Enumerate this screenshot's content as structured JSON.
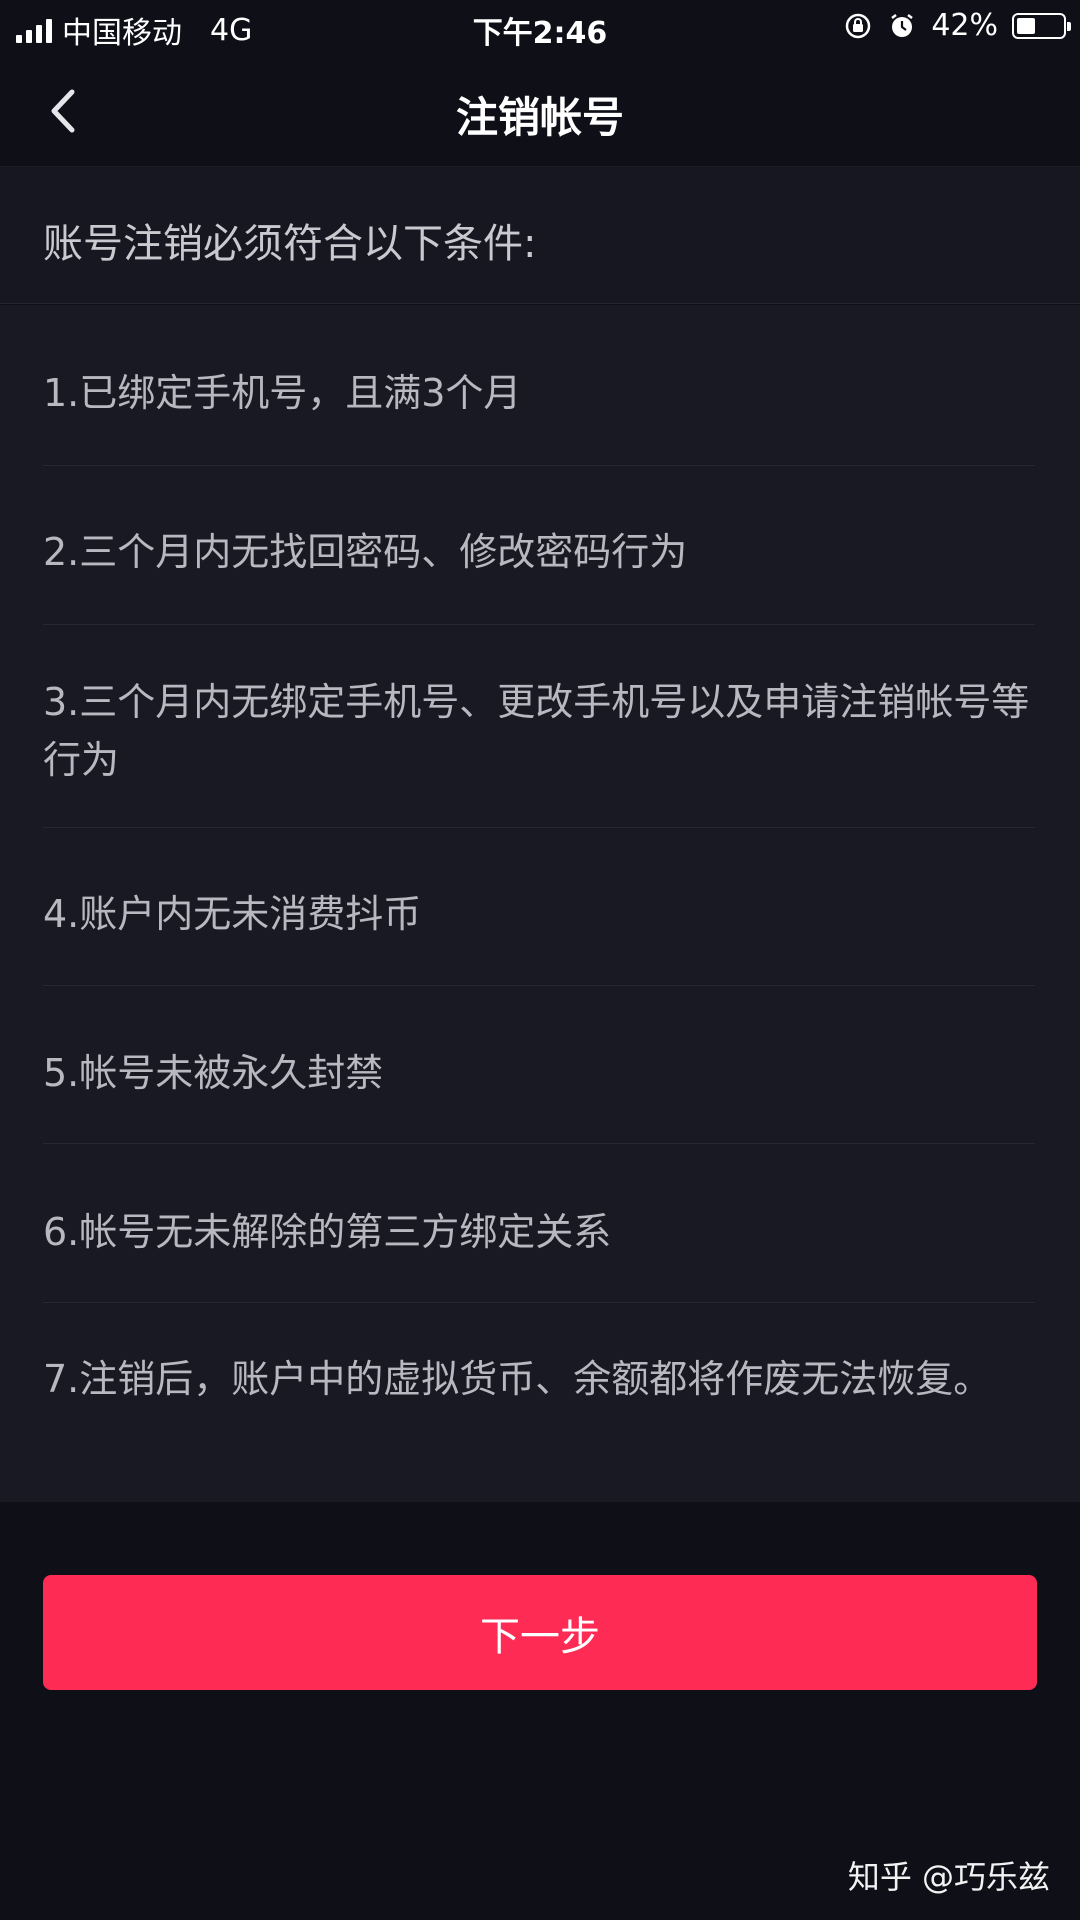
{
  "status_bar": {
    "carrier": "中国移动",
    "network": "4G",
    "time": "下午2:46",
    "battery_percent": "42%",
    "battery_level": 0.42
  },
  "nav": {
    "title": "注销帐号"
  },
  "header": {
    "text": "账号注销必须符合以下条件:"
  },
  "conditions": [
    "1.已绑定手机号，且满3个月",
    "2.三个月内无找回密码、修改密码行为",
    "3.三个月内无绑定手机号、更改手机号以及申请注销帐号等行为",
    "4.账户内无未消费抖币",
    "5.帐号未被永久封禁",
    "6.帐号无未解除的第三方绑定关系",
    "7.注销后，账户中的虚拟货币、余额都将作废无法恢复。"
  ],
  "next_button": {
    "label": "下一步"
  },
  "watermark": {
    "text": "知乎 @巧乐兹"
  },
  "colors": {
    "background": "#0f0f18",
    "list_background": "#191924",
    "accent": "#fe2c55"
  }
}
